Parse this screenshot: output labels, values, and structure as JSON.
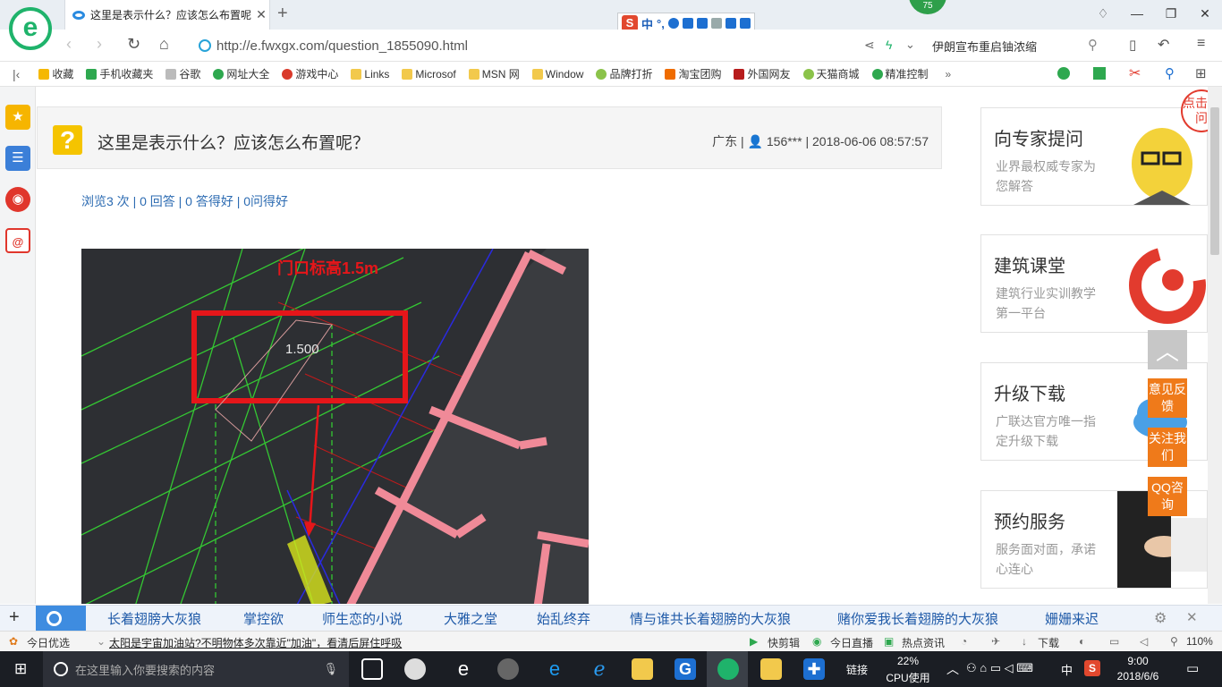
{
  "browser": {
    "tab_title": "这里是表示什么？应该怎么布置呢",
    "url": "http://e.fwxgx.com/question_1855090.html",
    "search_text": "伊朗宣布重启铀浓缩",
    "ime_label": "中",
    "ime_punct": "°,",
    "badge_count": "75"
  },
  "bookmarks": [
    "收藏",
    "手机收藏夹",
    "谷歌",
    "网址大全",
    "游戏中心",
    "Links",
    "Microsof",
    "MSN 网",
    "Window",
    "品牌打折",
    "淘宝团购",
    "外国网友",
    "天猫商城",
    "精准控制"
  ],
  "question": {
    "title": "这里是表示什么？应该怎么布置呢？",
    "meta_region": "广东 |",
    "meta_user": "156***",
    "meta_time": "| 2018-06-06 08:57:57",
    "stats": "浏览3 次 | 0 回答 | 0 答得好 | 0问得好",
    "image_caption": "门口标高1.5m",
    "image_label": "1.500"
  },
  "sidebar": [
    {
      "title": "向专家提问",
      "desc": "业界最权威专家为您解答"
    },
    {
      "title": "建筑课堂",
      "desc": "建筑行业实训教学第一平台"
    },
    {
      "title": "升级下载",
      "desc": "广联达官方唯一指定升级下载"
    },
    {
      "title": "预约服务",
      "desc": "服务面对面，承诺心连心"
    }
  ],
  "float_buttons": [
    "意见反馈",
    "关注我们",
    "QQ咨询"
  ],
  "float_corner": "点击提问",
  "hot_words": [
    "长着翅膀大灰狼",
    "掌控欲",
    "师生恋的小说",
    "大雅之堂",
    "始乱终弃",
    "情与谁共长着翅膀的大灰狼",
    "赌你爱我长着翅膀的大灰狼",
    "姗姗来迟"
  ],
  "status": {
    "left": "今日优选",
    "news": "太阳是宇宙加油站?不明物体多次靠近\"加油\"，看清后屏住呼吸",
    "kuaijian": "快剪辑",
    "live": "今日直播",
    "hotnews": "热点资讯",
    "download": "下载",
    "zoom": "110%"
  },
  "taskbar": {
    "search_placeholder": "在这里输入你要搜索的内容",
    "link": "链接",
    "cpu": "22%",
    "cpu_label": "CPU使用",
    "lang": "中",
    "time": "9:00",
    "date": "2018/6/6"
  }
}
